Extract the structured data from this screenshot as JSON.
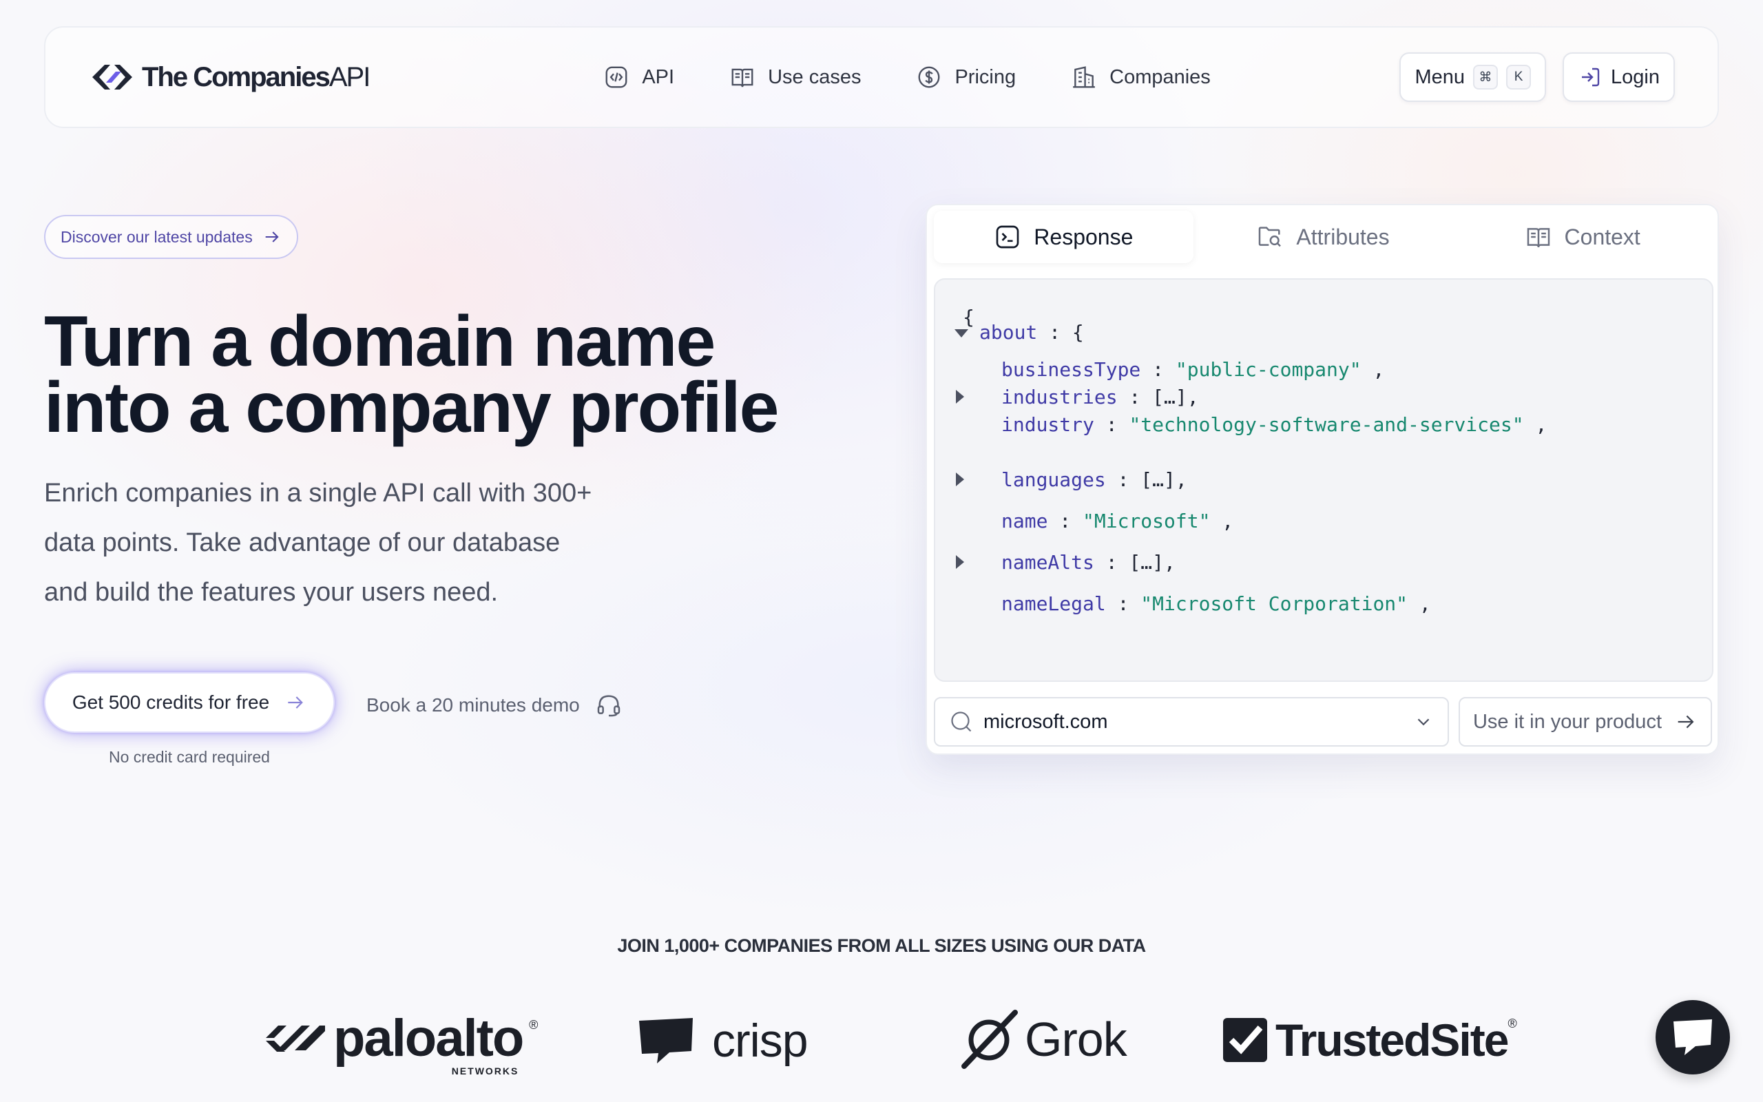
{
  "brand": {
    "name_bold": "The Companies",
    "name_light": "API"
  },
  "nav": {
    "links": [
      {
        "label": "API",
        "icon": "code-icon"
      },
      {
        "label": "Use cases",
        "icon": "book-icon"
      },
      {
        "label": "Pricing",
        "icon": "dollar-icon"
      },
      {
        "label": "Companies",
        "icon": "building-icon"
      }
    ],
    "menu_label": "Menu",
    "menu_shortcut": [
      "⌘",
      "K"
    ],
    "login_label": "Login"
  },
  "hero": {
    "update_pill": "Discover our latest updates",
    "headline_line1": "Turn a domain name",
    "headline_line2": "into a company profile",
    "sub_line1": "Enrich companies in a single API call with 300+",
    "sub_line2": "data points. Take advantage of our database",
    "sub_line3": "and build the features your users need.",
    "cta_label": "Get 500 credits for free",
    "cta_note": "No credit card required",
    "demo_label": "Book a 20 minutes demo"
  },
  "panel": {
    "tabs": [
      {
        "label": "Response",
        "icon": "terminal-icon",
        "active": true
      },
      {
        "label": "Attributes",
        "icon": "folder-search-icon",
        "active": false
      },
      {
        "label": "Context",
        "icon": "book-icon",
        "active": false
      }
    ],
    "code": {
      "open_brace": "{",
      "about_key": "about",
      "about_sep": " : {",
      "lines": [
        {
          "key": "businessType",
          "value": "\"public-company\"",
          "suffix": " ,",
          "collapsed": false
        },
        {
          "key": "industries",
          "value": "[…],",
          "suffix": "",
          "collapsed": true
        },
        {
          "key": "industry",
          "value": "\"technology-software-and-services\"",
          "suffix": " ,",
          "collapsed": false
        },
        {
          "key": "languages",
          "value": "[…],",
          "suffix": "",
          "collapsed": true
        },
        {
          "key": "name",
          "value": "\"Microsoft\"",
          "suffix": " ,",
          "collapsed": false
        },
        {
          "key": "nameAlts",
          "value": "[…],",
          "suffix": "",
          "collapsed": true
        },
        {
          "key": "nameLegal",
          "value": "\"Microsoft Corporation\"",
          "suffix": " ,",
          "collapsed": false
        }
      ]
    },
    "domain_value": "microsoft.com",
    "use_button": "Use it in your product"
  },
  "social_proof": {
    "heading": "JOIN 1,000+ COMPANIES FROM ALL SIZES USING OUR DATA",
    "logos": [
      {
        "name": "paloalto",
        "sub": "NETWORKS",
        "mark": "®"
      },
      {
        "name": "crisp"
      },
      {
        "name": "Grok"
      },
      {
        "name": "TrustedSite",
        "mark": "®"
      }
    ]
  },
  "colors": {
    "accent": "#4f46a5",
    "string": "#17886f",
    "key": "#3f3aa6",
    "text": "#111827"
  }
}
